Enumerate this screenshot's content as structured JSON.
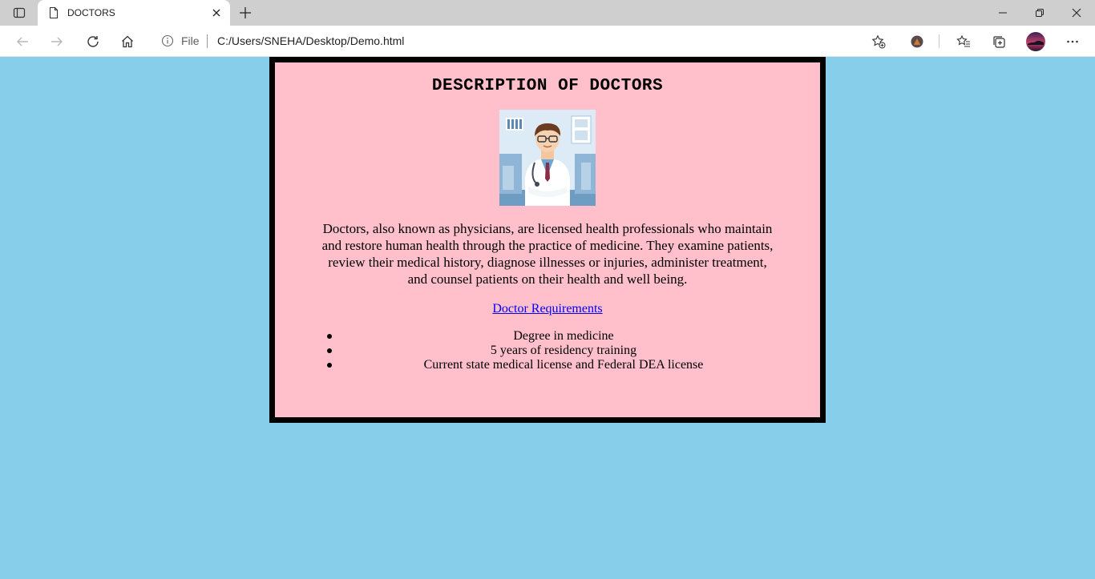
{
  "browser": {
    "tab": {
      "title": "DOCTORS"
    },
    "address_bar": {
      "scheme_label": "File",
      "url": "C:/Users/SNEHA/Desktop/Demo.html"
    },
    "icons": {
      "tab_actions": "tab-actions-icon",
      "favicon": "page-icon",
      "close_tab": "close-icon",
      "new_tab": "plus-icon",
      "minimize": "minimize-icon",
      "restore": "restore-icon",
      "close_window": "close-icon",
      "back": "back-arrow-icon",
      "forward": "forward-arrow-icon",
      "refresh": "refresh-icon",
      "home": "home-icon",
      "site_info": "info-icon",
      "add_favorite": "star-plus-icon",
      "extension": "extension-icon",
      "favorites": "favorites-icon",
      "collections": "collections-icon",
      "profile": "profile-avatar",
      "menu": "more-icon"
    }
  },
  "page": {
    "background": "#87ceeb",
    "box_background": "#ffc0cb",
    "box_border": "#000000",
    "heading": "DESCRIPTION OF DOCTORS",
    "image_subject": "doctor-illustration",
    "description_lines": [
      "Doctors, also known as physicians, are licensed health professionals who maintain",
      "and restore human health through the practice of medicine. They examine patients,",
      "review their medical history, diagnose illnesses or injuries, administer treatment,",
      "and counsel patients on their health and well being."
    ],
    "link_text": "Doctor Requirements",
    "requirements": [
      "Degree in medicine",
      "5 years of residency training",
      "Current state medical license and Federal DEA license"
    ]
  }
}
